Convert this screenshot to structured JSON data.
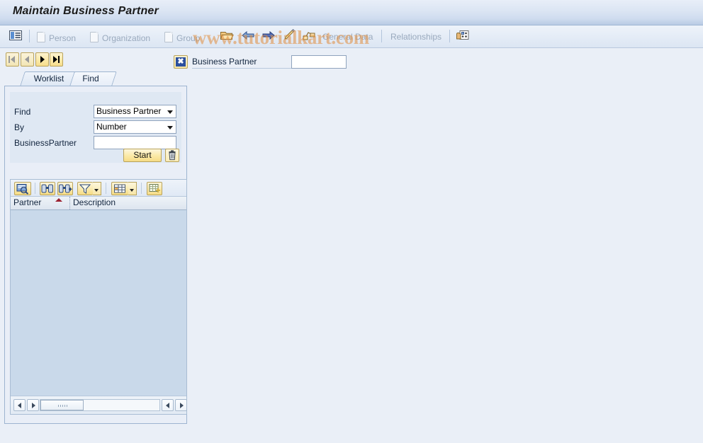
{
  "window": {
    "title": "Maintain Business Partner"
  },
  "watermark": {
    "text": "www.tutorialkart.com"
  },
  "toolbar": {
    "list_icon": "list-detail-icon",
    "items": [
      {
        "label": "Person",
        "icon": "document-icon",
        "enabled": false
      },
      {
        "label": "Organization",
        "icon": "document-icon",
        "enabled": false
      },
      {
        "label": "Group",
        "icon": "document-icon",
        "enabled": false
      }
    ],
    "icon_buttons": [
      {
        "name": "open-folder-icon"
      },
      {
        "name": "arrow-left-icon"
      },
      {
        "name": "arrow-right-icon"
      },
      {
        "name": "pencil-edit-icon"
      },
      {
        "name": "relationship-node-icon"
      }
    ],
    "general_data_label": "General Data",
    "relationships_label": "Relationships",
    "person_card_icon": "person-card-icon"
  },
  "navigation": {
    "first_label": "First",
    "previous_label": "Previous",
    "next_label": "Next",
    "last_label": "Last"
  },
  "business_partner": {
    "close_icon": "close-x-icon",
    "label": "Business Partner",
    "value": "",
    "placeholder": ""
  },
  "tabs": [
    {
      "label": "Worklist",
      "active": false
    },
    {
      "label": "Find",
      "active": true
    }
  ],
  "find_panel": {
    "rows": [
      {
        "label": "Find",
        "value": "Business Partner",
        "type": "select"
      },
      {
        "label": "By",
        "value": "Number",
        "type": "select"
      },
      {
        "label": "BusinessPartner",
        "value": "",
        "type": "text"
      }
    ],
    "start_label": "Start",
    "delete_icon": "trash-icon"
  },
  "grid": {
    "toolbar": [
      {
        "name": "detail-magnifier-icon",
        "dropdown": false
      },
      {
        "name": "find-binoculars-icon",
        "dropdown": false
      },
      {
        "name": "find-next-binoculars-icon",
        "dropdown": false
      },
      {
        "name": "filter-funnel-icon",
        "dropdown": true
      },
      {
        "name": "layout-table-icon",
        "dropdown": true
      },
      {
        "name": "export-spreadsheet-icon",
        "dropdown": false
      }
    ],
    "columns": [
      {
        "label": "Partner",
        "sorted": true,
        "sort_dir": "asc"
      },
      {
        "label": "Description",
        "sorted": false
      }
    ],
    "rows": []
  },
  "colors": {
    "titlebar_top": "#e8eef8",
    "titlebar_bottom": "#b9cbe4",
    "panel_bg": "#e9eef7",
    "grid_body": "#c9d9ea",
    "button_yellow": "#fae9ad",
    "accent_blue": "#2b4f9e",
    "sort_marker": "#9c2130",
    "watermark_orange": "#e08c3c",
    "disabled_text": "#99a9bd"
  }
}
